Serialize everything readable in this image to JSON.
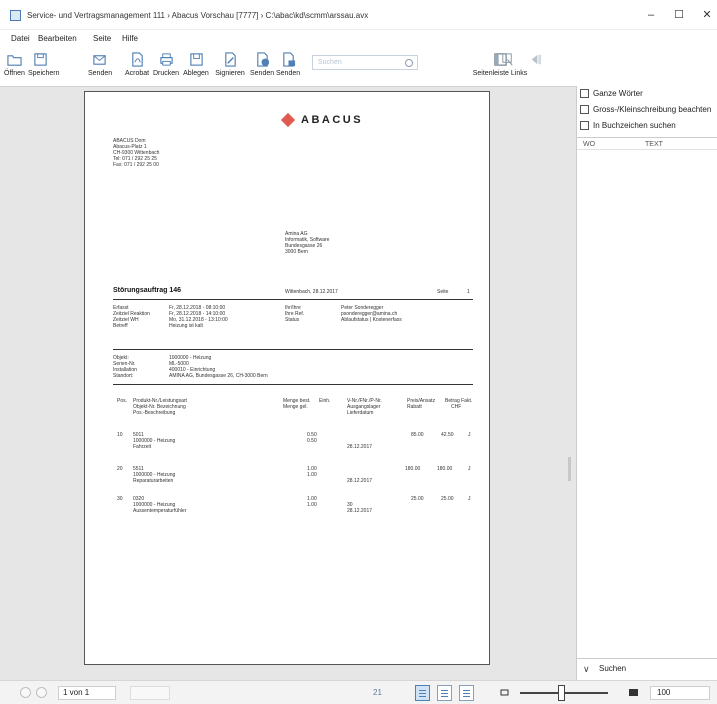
{
  "window": {
    "title": "Service- und Vertragsmanagement 111 › Abacus Vorschau [7777] › C:\\abac\\kd\\scmm\\arssau.avx",
    "minimize_glyph": "–",
    "maximize_glyph": "☐",
    "close_glyph": "✕"
  },
  "menu": [
    "Datei",
    "Bearbeiten",
    "Seite",
    "Hilfe"
  ],
  "toolbar": {
    "open": "Öffnen",
    "save": "Speichern",
    "send": "Senden",
    "acrobat": "Acrobat",
    "print": "Drucken",
    "file": "Ablegen",
    "sign": "Signieren",
    "send2": "Senden",
    "send3": "Senden",
    "search_placeholder": "Suchen",
    "sidebar_left": "Seitenleiste Links",
    "icons": {
      "open": "folder-open-icon",
      "save": "floppy-disk-icon",
      "send": "mail-send-icon",
      "acrobat": "pdf-icon",
      "print": "printer-icon",
      "file": "archive-icon",
      "sign": "signature-icon",
      "send2": "send-globe-icon",
      "send3": "send-lock-icon",
      "sidebar_left": "sidebar-icon"
    }
  },
  "document": {
    "logo_text": "ABACUS",
    "sender": [
      "ABACUS Dom",
      "Abacus-Platz 1",
      "CH-9300 Wittenbach",
      "Tel: 071 / 292 25 25",
      "Fax: 071 / 292 25 00"
    ],
    "recipient": [
      "Amina AG",
      "Informatik, Software",
      "Bundesgasse 26",
      "3000 Bern"
    ],
    "order_title": "Störungsauftrag 146",
    "order_date": "Wittenbach, 28.12.2017",
    "page_label": "Seite",
    "page_number": "1",
    "info_left": [
      [
        "Erfasst",
        "Fr, 28.12.2018 - 08:10:00"
      ],
      [
        "Zeitziel Reaktion",
        "Fr, 28.12.2018 - 14:10:00"
      ],
      [
        "Zeitziel WH",
        "Mo, 31.12.2018 - 13:10:00"
      ],
      [
        "Betreff",
        "Heizung ist kalt"
      ]
    ],
    "info_right": [
      [
        "Ihr/Ihre",
        "Peter Sonderegger"
      ],
      [
        "Ihre Ref.",
        "psonderegger@amina.ch"
      ],
      [
        "Status",
        "Ablaufstatus | Kostenerfass"
      ]
    ],
    "object_info": [
      [
        "Objekt:",
        "1000000 - Heizung"
      ],
      [
        "Serien-Nr.",
        "ML-5000"
      ],
      [
        "Installation",
        "400010 - Einrichtung"
      ],
      [
        "Standort:",
        "AMINA AG, Bundesgasse 26, CH-3000 Bern"
      ]
    ],
    "columns": {
      "pos": "Pos.",
      "product": "Produkt-Nr./Leistungsart",
      "product2": "Objekt-Nr. Bezeichnung",
      "product3": "Pos.-Beschreibung",
      "qty": "Menge best.",
      "qty2": "Menge gel.",
      "unit": "Einh.",
      "vnr": "V-Nr./FNr./P-Nr.",
      "vnr2": "Ausgangslager",
      "vnr3": "Lieferdatum",
      "price": "Preis/Ansatz",
      "price2": "Rabatt",
      "amount": "Betrag Fakt.",
      "amount2": "CHF"
    },
    "items": [
      {
        "pos": "10",
        "product": "5011",
        "object": "1000000 - Heizung",
        "desc": "Fahrzeit",
        "qty": "0.50",
        "qty2": "0.50",
        "vnr": "",
        "date": "28.12.2017",
        "price": "85.00",
        "amount": "42.50",
        "flag": "J"
      },
      {
        "pos": "20",
        "product": "5511",
        "object": "1000000 - Heizung",
        "desc": "Reparaturarbeiten",
        "qty": "1.00",
        "qty2": "1.00",
        "vnr": "",
        "date": "28.12.2017",
        "price": "180.00",
        "amount": "180.00",
        "flag": "J"
      },
      {
        "pos": "30",
        "product": "0320",
        "object": "1000000 - Heizung",
        "desc": "Aussentemperaturfühler",
        "qty": "1.00",
        "qty2": "1.00",
        "vnr": "30",
        "date": "28.12.2017",
        "price": "25.00",
        "amount": "25.00",
        "flag": "J"
      }
    ]
  },
  "right_panel": {
    "whole_words": "Ganze Wörter",
    "match_case": "Gross-/Kleinschreibung beachten",
    "in_bookmarks": "In Buchzeichen suchen",
    "col_wo": "WO",
    "col_text": "TEXT",
    "search_label": "Suchen",
    "chevron_glyph": "∨"
  },
  "statusbar": {
    "page_indicator": "1 von 1",
    "page_count": "21",
    "zoom_value": "100"
  },
  "colors": {
    "logo_accent": "#e05a4f",
    "toolbar_icon": "#4f7fb3",
    "view_active": "#cfe2f6"
  }
}
